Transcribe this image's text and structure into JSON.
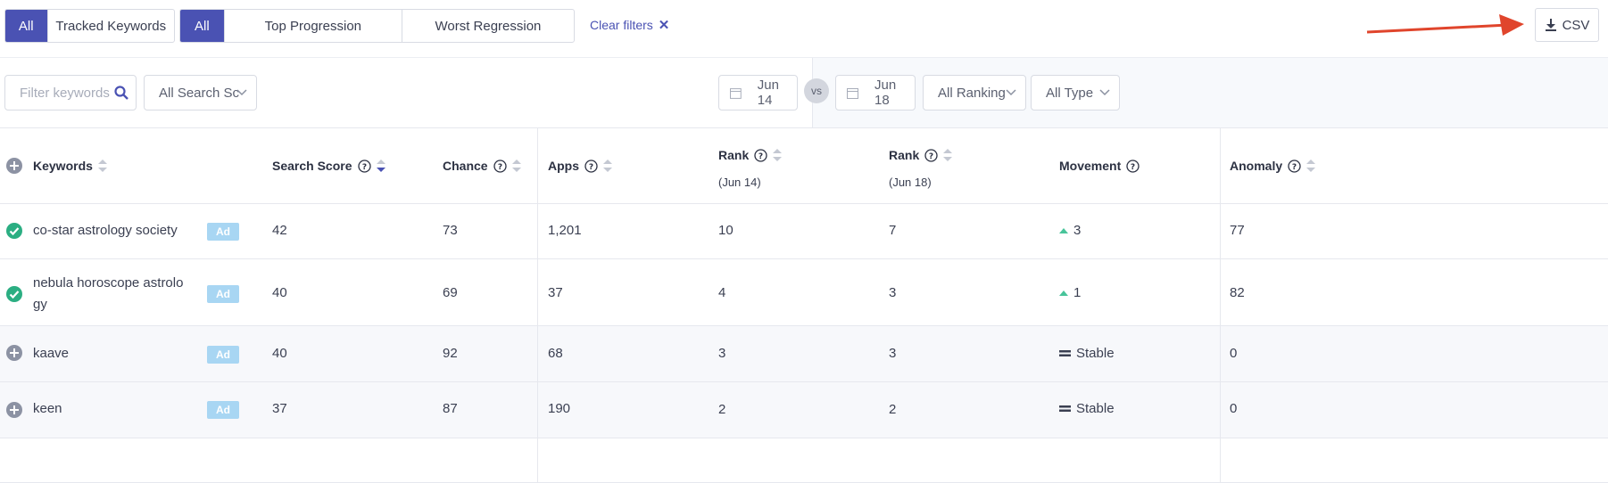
{
  "filters": {
    "scope_tabs": [
      {
        "label": "All",
        "active": true
      },
      {
        "label": "Tracked Keywords",
        "active": false
      }
    ],
    "trend_tabs": [
      {
        "label": "All",
        "active": true
      },
      {
        "label": "Top Progression",
        "active": false
      },
      {
        "label": "Worst Regression",
        "active": false
      }
    ],
    "clear_label": "Clear filters",
    "csv_label": "CSV"
  },
  "controls": {
    "search_placeholder": "Filter keywords",
    "search_score_select": "All Search Sc",
    "date_from": "Jun 14",
    "vs_label": "vs",
    "date_to": "Jun 18",
    "ranking_select": "All Ranking",
    "type_select": "All Type"
  },
  "table": {
    "headers": {
      "keywords": "Keywords",
      "search_score": "Search Score",
      "chance": "Chance",
      "apps": "Apps",
      "rank1": "Rank",
      "rank1_sub": "(Jun 14)",
      "rank2": "Rank",
      "rank2_sub": "(Jun 18)",
      "movement": "Movement",
      "anomaly": "Anomaly"
    },
    "rows": [
      {
        "keyword": "co-star astrology society",
        "tracked": true,
        "badge": "Ad",
        "search_score": "42",
        "chance": "73",
        "apps": "1,201",
        "rank1": "10",
        "rank2": "7",
        "movement": "3",
        "movement_type": "up",
        "anomaly": "77"
      },
      {
        "keyword_line1": "nebula horoscope astrolo",
        "keyword_line2": "gy",
        "tracked": true,
        "badge": "Ad",
        "search_score": "40",
        "chance": "69",
        "apps": "37",
        "rank1": "4",
        "rank2": "3",
        "movement": "1",
        "movement_type": "up",
        "anomaly": "82"
      },
      {
        "keyword": "kaave",
        "tracked": false,
        "badge": "Ad",
        "search_score": "40",
        "chance": "92",
        "apps": "68",
        "rank1": "3",
        "rank2": "3",
        "movement": "Stable",
        "movement_type": "stable",
        "anomaly": "0"
      },
      {
        "keyword": "keen",
        "tracked": false,
        "badge": "Ad",
        "search_score": "37",
        "chance": "87",
        "apps": "190",
        "rank1": "2",
        "rank2": "2",
        "movement": "Stable",
        "movement_type": "stable",
        "anomaly": "0"
      }
    ]
  },
  "colors": {
    "accent": "#4a52b3",
    "tracked_green": "#2bae82",
    "up_green": "#48c49a",
    "ad_badge": "#a8d6f3",
    "arrow_red": "#e0452c"
  }
}
